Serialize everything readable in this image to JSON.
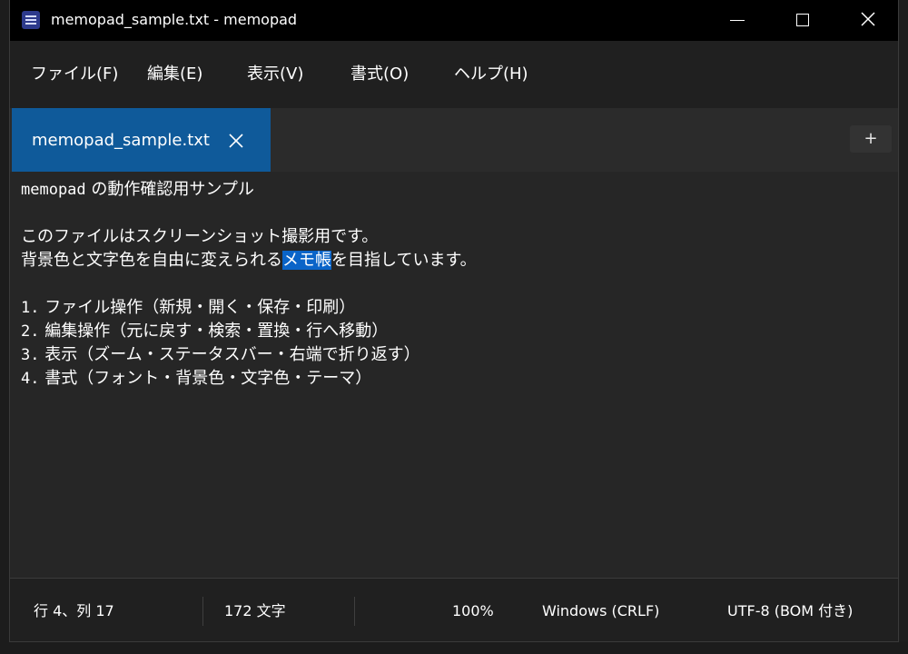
{
  "window": {
    "title": "memopad_sample.txt - memopad",
    "app_icon": "notepad-list-icon"
  },
  "window_controls": {
    "minimize_icon": "minimize-icon",
    "maximize_icon": "maximize-icon",
    "close_icon": "close-icon"
  },
  "menu": {
    "items": [
      {
        "label": "ファイル(F)"
      },
      {
        "label": "編集(E)"
      },
      {
        "label": "表示(V)"
      },
      {
        "label": "書式(O)"
      },
      {
        "label": "ヘルプ(H)"
      }
    ]
  },
  "tabs": {
    "items": [
      {
        "label": "memopad_sample.txt",
        "active": true
      }
    ],
    "close_icon": "close-icon",
    "add_label": "+"
  },
  "editor": {
    "lines": [
      {
        "pre_mono": "memopad",
        "text": " の動作確認用サンプル"
      },
      {
        "text": ""
      },
      {
        "text": "このファイルはスクリーンショット撮影用です。"
      },
      {
        "before": "背景色と文字色を自由に変えられる",
        "selected": "メモ帳",
        "after": "を目指しています。"
      },
      {
        "text": ""
      },
      {
        "num": "1.",
        "text": " ファイル操作（新規・開く・保存・印刷）"
      },
      {
        "num": "2.",
        "text": " 編集操作（元に戻す・検索・置換・行へ移動）"
      },
      {
        "num": "3.",
        "text": " 表示（ズーム・ステータスバー・右端で折り返す）"
      },
      {
        "num": "4.",
        "text": " 書式（フォント・背景色・文字色・テーマ）"
      }
    ]
  },
  "status": {
    "position": "行 4、列 17",
    "char_count": "172 文字",
    "zoom": "100%",
    "line_ending": "Windows (CRLF)",
    "encoding": "UTF-8 (BOM 付き)"
  },
  "colors": {
    "titlebar": "#000000",
    "background": "#202020",
    "editor": "#262626",
    "tab_active": "#0f5a9a",
    "selection": "#0a64c8",
    "text": "#ffffff"
  }
}
